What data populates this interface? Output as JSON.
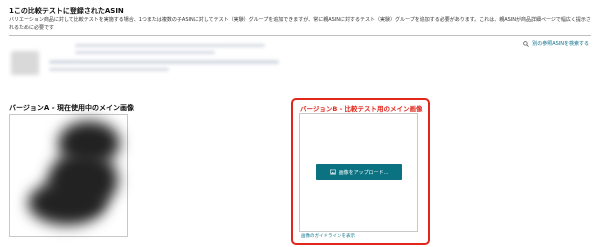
{
  "header": {
    "title": "1この比較テストに登録されたASIN",
    "description": "バリエーション商品に対して比較テストを実施する場合、1つまたは複数の子ASINに対してテスト（実験）グループを追加できますが、常に親ASINに対するテスト（実験）グループを追加する必要があります。これは、親ASINが商品詳細ページで幅広く提示されるために必要です"
  },
  "search_link": {
    "label": "別の参照ASINを検索する",
    "icon": "search-icon"
  },
  "version_a": {
    "heading": "バージョンA - 現在使用中のメイン画像"
  },
  "version_b": {
    "heading": "バージョンB - 比較テスト用のメイン画像",
    "upload_label": "画像をアップロード...",
    "upload_icon": "image-icon",
    "guideline_link": "画像のガイドラインを表示"
  },
  "colors": {
    "accent_teal": "#0b7282",
    "highlight_red": "#e1261c"
  }
}
